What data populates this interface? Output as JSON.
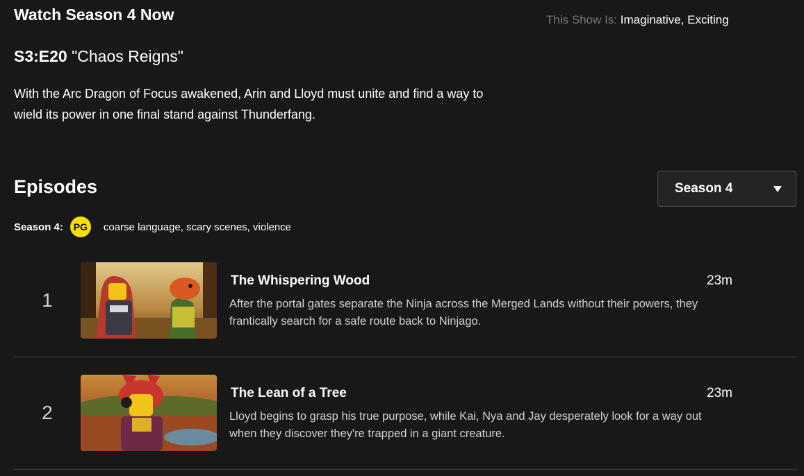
{
  "header": {
    "watch_title": "Watch Season 4 Now",
    "show_is_label": "This Show Is:",
    "show_is_value": "Imaginative, Exciting"
  },
  "featured_episode": {
    "code": "S3:E20",
    "title": "\"Chaos Reigns\"",
    "description": "With the Arc Dragon of Focus awakened, Arin and Lloyd must unite and find a way to wield its power in one final stand against Thunderfang."
  },
  "episodes_section": {
    "title": "Episodes",
    "season_selector": {
      "selected": "Season 4",
      "icon": "caret-down"
    },
    "season_label": "Season 4:",
    "rating": "PG",
    "advisories": "coarse language, scary scenes, violence"
  },
  "episodes": [
    {
      "number": "1",
      "title": "The Whispering Wood",
      "duration": "23m",
      "synopsis": "After the portal gates separate the Ninja across the Merged Lands without their powers, they frantically search for a safe route back to Ninjago."
    },
    {
      "number": "2",
      "title": "The Lean of a Tree",
      "duration": "23m",
      "synopsis": "Lloyd begins to grasp his true purpose, while Kai, Nya and Jay desperately look for a way out when they discover they're trapped in a giant creature."
    }
  ]
}
